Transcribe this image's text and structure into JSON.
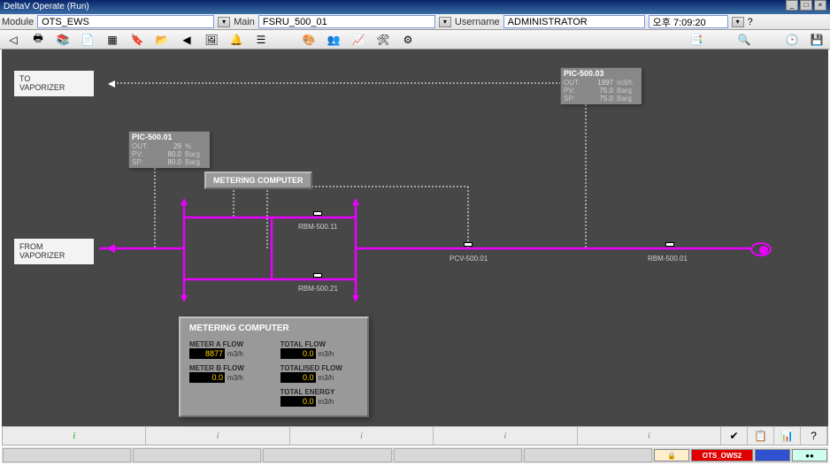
{
  "window": {
    "title": "DeltaV Operate (Run)"
  },
  "header": {
    "module_label": "Module",
    "module_value": "OTS_EWS",
    "main_label": "Main",
    "main_value": "FSRU_500_01",
    "user_label": "Username",
    "user_value": "ADMINISTRATOR",
    "time": "오후 7:09:20"
  },
  "pid": {
    "to_label": "TO\nVAPORIZER",
    "from_label": "FROM\nVAPORIZER",
    "pic01": {
      "tag": "PIC-500.01",
      "out": "29",
      "out_u": "%",
      "pv": "80.0",
      "pv_u": "Barg",
      "sp": "80.0",
      "sp_u": "Barg"
    },
    "pic03": {
      "tag": "PIC-500.03",
      "out": "1997",
      "out_u": "m3/h",
      "pv": "75.0",
      "pv_u": "Barg",
      "sp": "75.0",
      "sp_u": "Barg"
    },
    "mc_label": "METERING COMPUTER",
    "devices": {
      "rbm11": "RBM-500.11",
      "rbm21": "RBM-500.21",
      "pcv": "PCV-500.01",
      "rbm01": "RBM-500.01"
    }
  },
  "metering": {
    "title": "METERING COMPUTER",
    "meter_a_lbl": "METER A FLOW",
    "meter_a_val": "8877",
    "meter_a_unit": "m3/h",
    "meter_b_lbl": "METER B FLOW",
    "meter_b_val": "0.0",
    "meter_b_unit": "m3/h",
    "total_flow_lbl": "TOTAL FLOW",
    "total_flow_val": "0.0",
    "total_flow_unit": "m3/h",
    "totalised_lbl": "TOTALISED FLOW",
    "totalised_val": "0.0",
    "totalised_unit": "m3/h",
    "energy_lbl": "TOTAL ENERGY",
    "energy_val": "0.0",
    "energy_unit": "m3/h"
  },
  "bottom": {
    "station": "OTS_OWS2"
  },
  "info_char": "i"
}
